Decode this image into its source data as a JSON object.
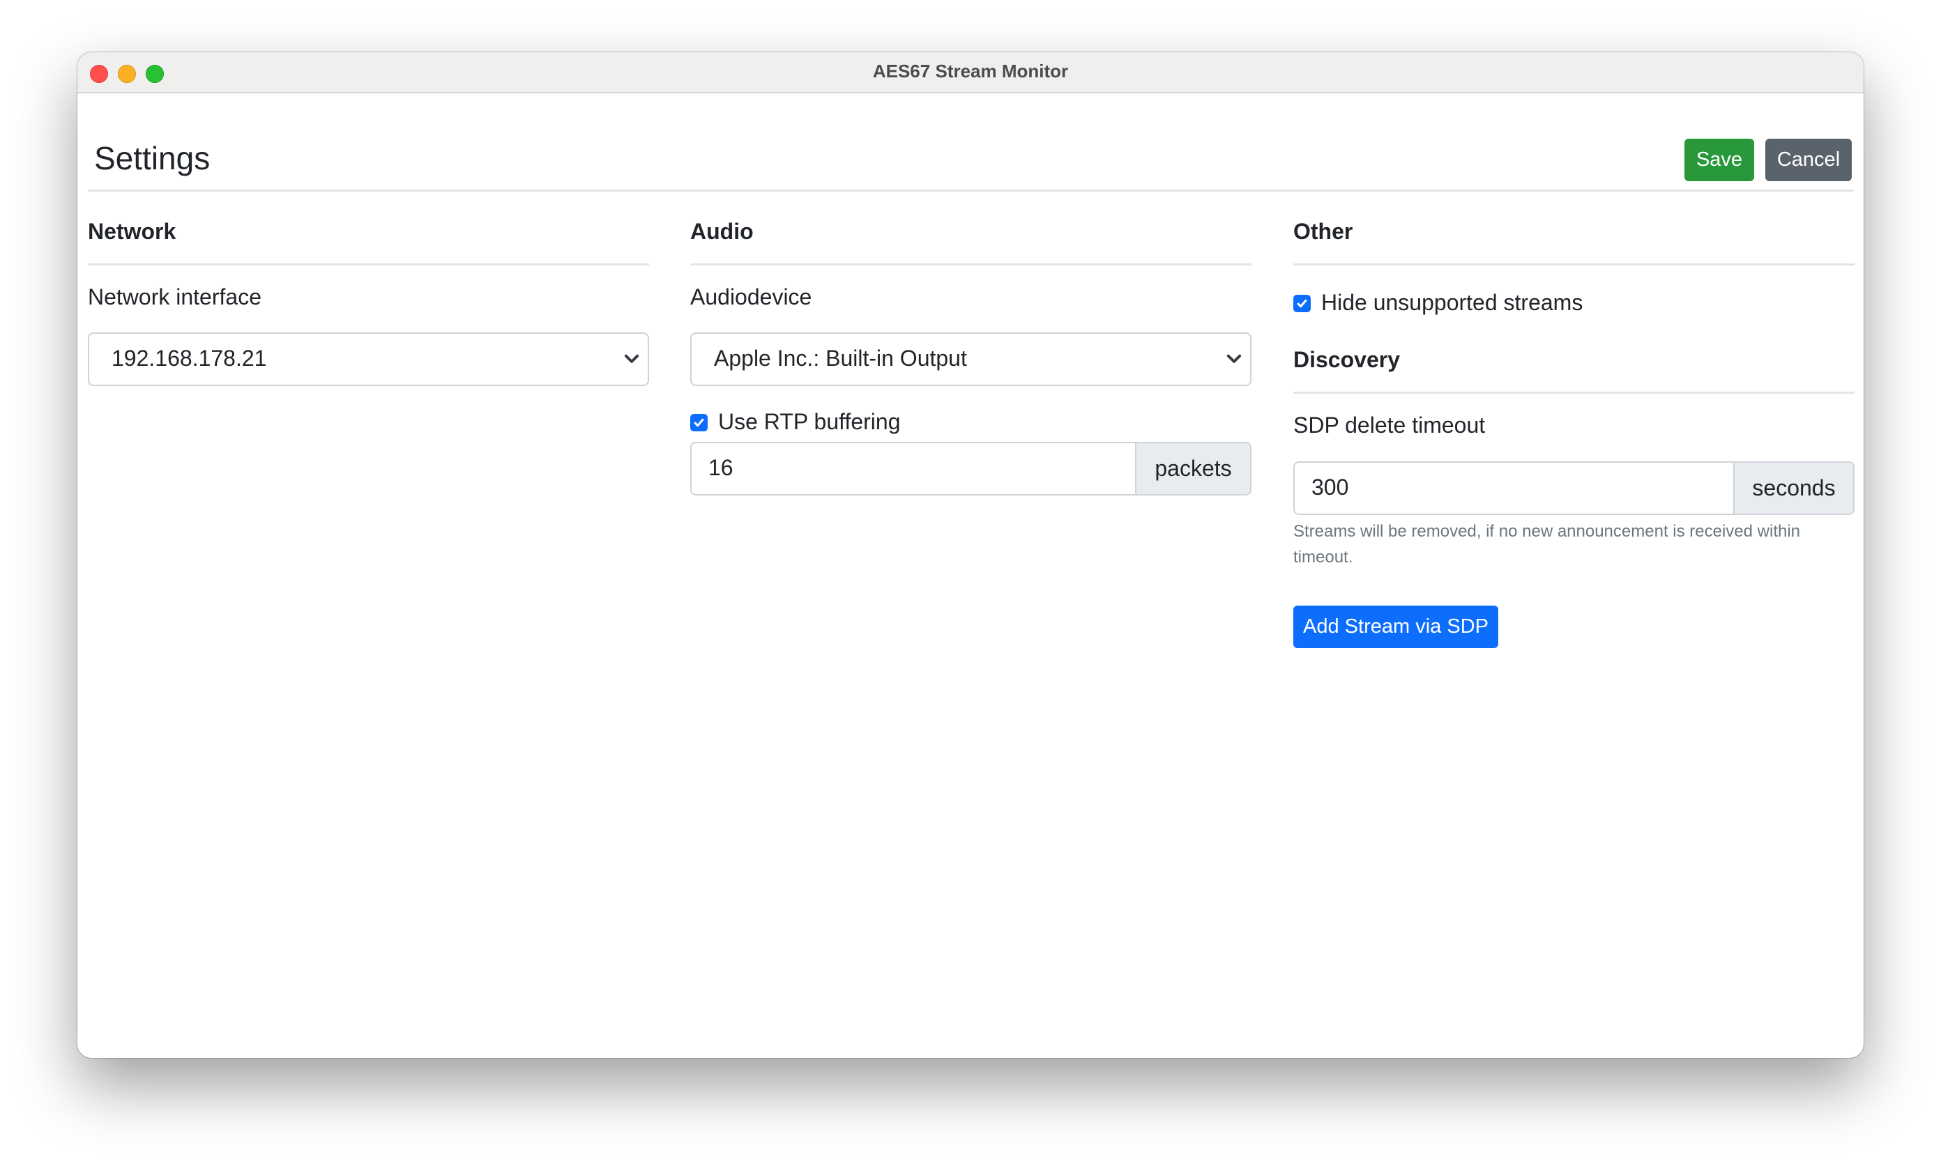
{
  "window": {
    "title": "AES67 Stream Monitor",
    "controls": [
      "close",
      "minimize",
      "maximize"
    ]
  },
  "header": {
    "title": "Settings",
    "save_label": "Save",
    "cancel_label": "Cancel"
  },
  "colors": {
    "save": "#28983b",
    "cancel": "#5a626b",
    "primary": "#0d6efd"
  },
  "network": {
    "section_title": "Network",
    "interface_label": "Network interface",
    "interface_value": "192.168.178.21"
  },
  "audio": {
    "section_title": "Audio",
    "device_label": "Audiodevice",
    "device_value": "Apple Inc.: Built-in Output",
    "rtp_buffering_label": "Use RTP buffering",
    "rtp_buffering_checked": true,
    "buffer_value": "16",
    "buffer_unit": "packets"
  },
  "other": {
    "section_title": "Other",
    "hide_unsupported_label": "Hide unsupported streams",
    "hide_unsupported_checked": true,
    "discovery_title": "Discovery",
    "sdp_timeout_label": "SDP delete timeout",
    "sdp_timeout_value": "300",
    "sdp_timeout_unit": "seconds",
    "sdp_timeout_help": "Streams will be removed, if no new announcement is received within timeout.",
    "add_stream_label": "Add Stream via SDP"
  }
}
